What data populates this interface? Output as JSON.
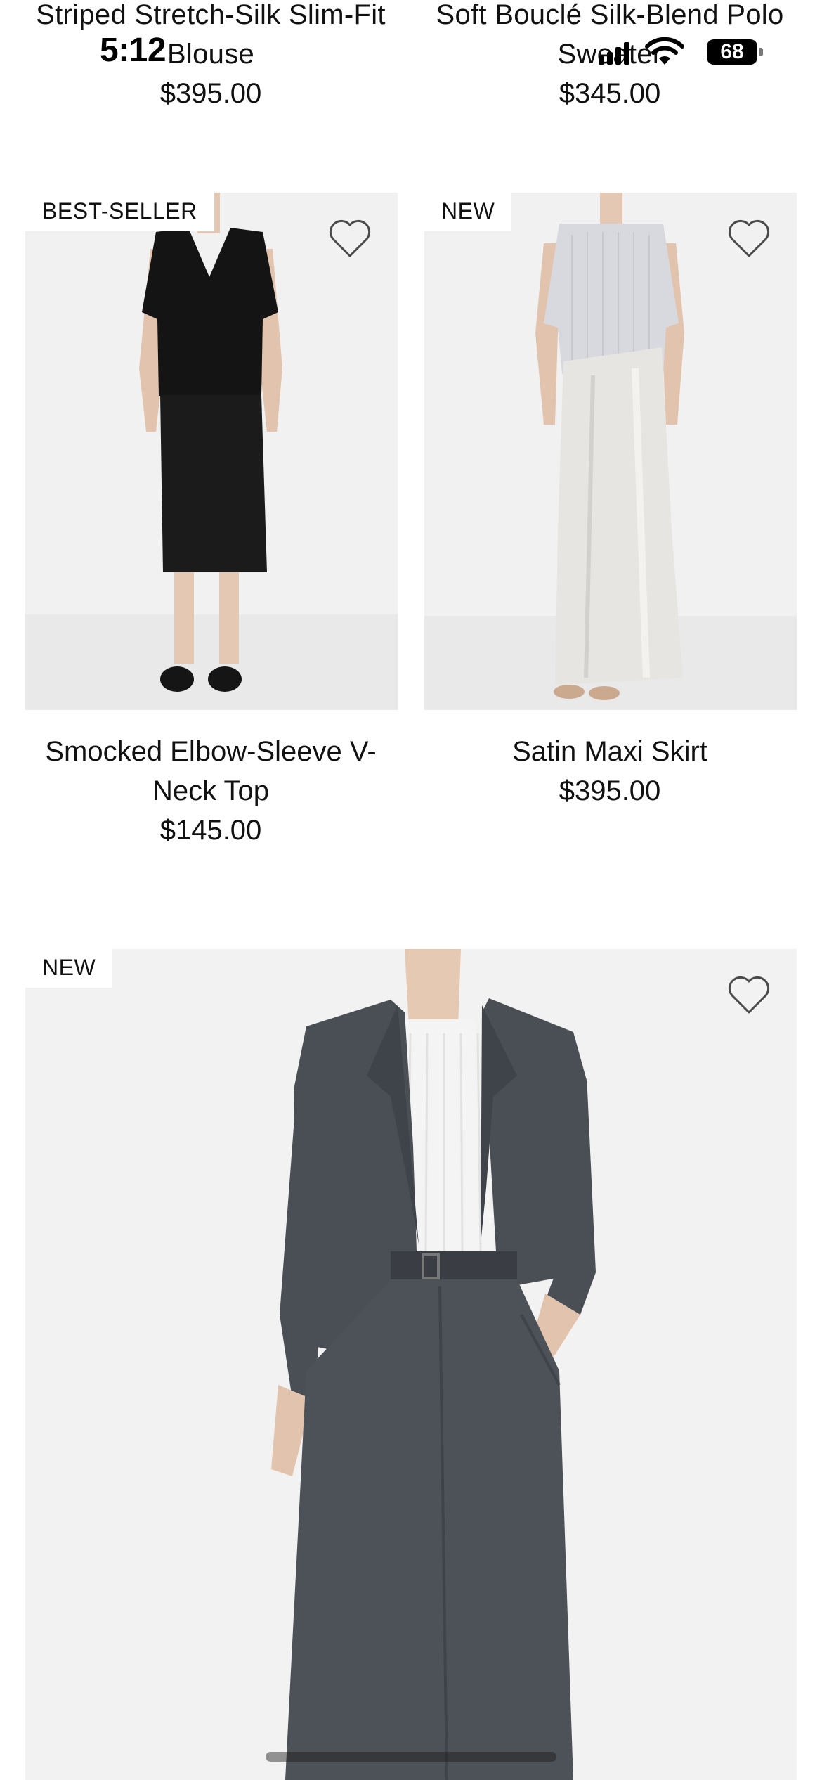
{
  "status_bar": {
    "time": "5:12",
    "battery": "68"
  },
  "top_products": [
    {
      "name_line1": "Striped Stretch-Silk Slim-Fit",
      "name_line2": "Blouse",
      "price": "$395.00"
    },
    {
      "name_line1": "Soft Bouclé Silk-Blend Polo",
      "name_line2": "Sweater",
      "price": "$345.00"
    }
  ],
  "products": [
    {
      "badge": "BEST-SELLER",
      "name_line1": "Smocked Elbow-Sleeve V-",
      "name_line2": "Neck Top",
      "price": "$145.00",
      "image_icon": "black-v-neck-top-and-skirt-photo"
    },
    {
      "badge": "NEW",
      "name_line1": "Satin Maxi Skirt",
      "price": "$395.00",
      "image_icon": "grey-knit-top-and-satin-maxi-skirt-photo"
    },
    {
      "badge": "NEW",
      "image_icon": "charcoal-blazer-and-trousers-photo"
    }
  ],
  "colors": {
    "image_bg": "#efefef",
    "heart_stroke": "#4a4a4a",
    "text": "#111111"
  }
}
